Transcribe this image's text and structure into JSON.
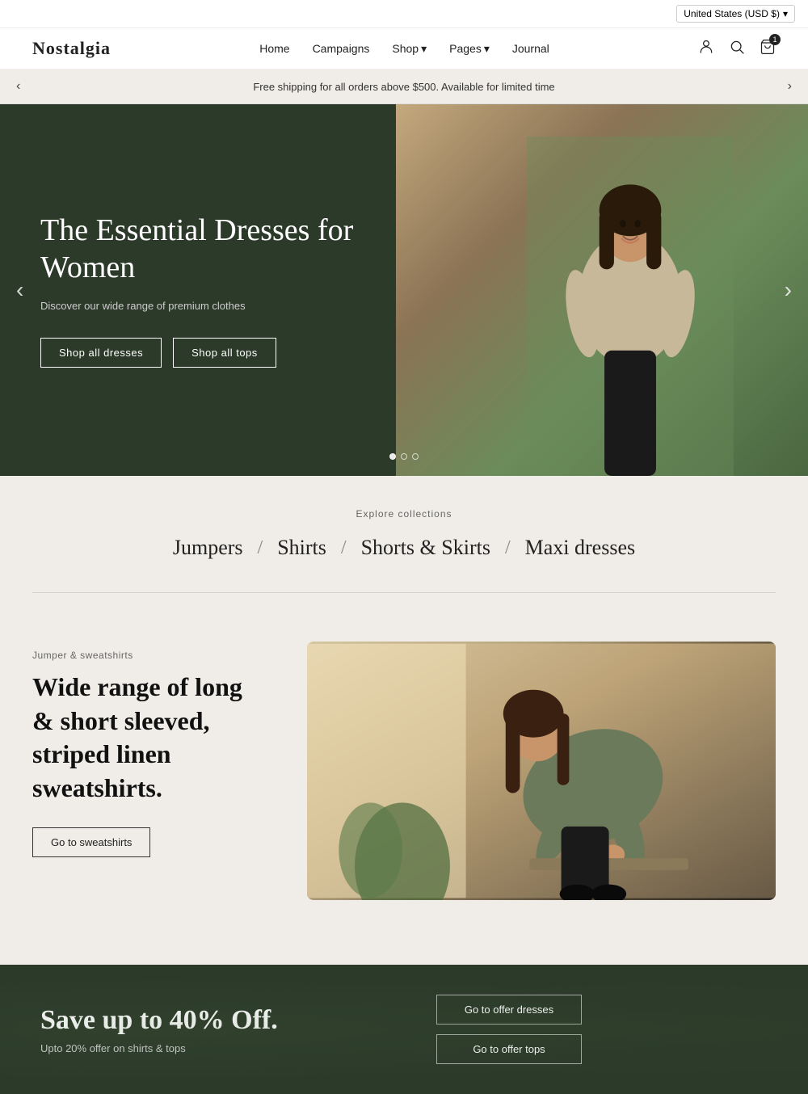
{
  "topbar": {
    "currency": "United States (USD $)",
    "currency_arrow": "▾"
  },
  "header": {
    "logo": "Nostalgia",
    "nav": [
      {
        "label": "Home",
        "has_arrow": false
      },
      {
        "label": "Campaigns",
        "has_arrow": false
      },
      {
        "label": "Shop",
        "has_arrow": true
      },
      {
        "label": "Pages",
        "has_arrow": true
      },
      {
        "label": "Journal",
        "has_arrow": false
      }
    ],
    "cart_count": "1"
  },
  "announcement": {
    "text": "Free shipping for all orders above $500. Available for limited time"
  },
  "hero": {
    "title": "The Essential Dresses for Women",
    "subtitle": "Discover our wide range of premium clothes",
    "btn1": "Shop all dresses",
    "btn2": "Shop all tops",
    "dots": [
      {
        "active": true
      },
      {
        "active": false
      },
      {
        "active": false
      }
    ]
  },
  "collections": {
    "heading": "Explore collections",
    "items": [
      {
        "label": "Jumpers"
      },
      {
        "separator": "/"
      },
      {
        "label": "Shirts"
      },
      {
        "separator": "/"
      },
      {
        "label": "Shorts & Skirts"
      },
      {
        "separator": "/"
      },
      {
        "label": "Maxi dresses"
      }
    ]
  },
  "jumper": {
    "category": "Jumper & sweatshirts",
    "title": "Wide range of long & short sleeved, striped linen sweatshirts.",
    "button": "Go to sweatshirts"
  },
  "sale": {
    "title": "Save up to 40% Off.",
    "subtitle": "Upto 20% offer on shirts & tops",
    "btn1": "Go to offer dresses",
    "btn2": "Go to offer tops"
  }
}
